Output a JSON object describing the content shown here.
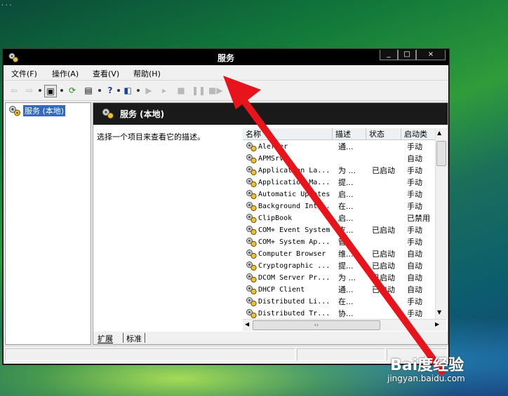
{
  "window": {
    "title": "服务",
    "controls": {
      "minimize": "_",
      "maximize": "□",
      "close": "×"
    }
  },
  "menubar": {
    "items": [
      {
        "label": "文件(F)"
      },
      {
        "label": "操作(A)"
      },
      {
        "label": "查看(V)"
      },
      {
        "label": "帮助(H)"
      }
    ]
  },
  "toolbar": {
    "icons": [
      "back-arrow-icon",
      "forward-arrow-icon",
      "show-hide-tree-icon",
      "refresh-icon",
      "export-list-icon",
      "help-icon",
      "console-view-icon",
      "start-service-icon",
      "play-icon",
      "stop-service-icon",
      "pause-service-icon",
      "restart-service-icon"
    ]
  },
  "tree": {
    "root_label": "服务 (本地)"
  },
  "right_pane": {
    "header_title": "服务 (本地)",
    "description_prompt": "选择一个项目来查看它的描述。",
    "columns": [
      "名称",
      "描述",
      "状态",
      "启动类"
    ],
    "rows": [
      {
        "name": "Alerter",
        "desc": "通...",
        "status": "",
        "startup": "手动"
      },
      {
        "name": "APMSrv",
        "desc": "",
        "status": "",
        "startup": "自动"
      },
      {
        "name": "Application La...",
        "desc": "为 ...",
        "status": "已启动",
        "startup": "手动"
      },
      {
        "name": "Application Ma...",
        "desc": "提...",
        "status": "",
        "startup": "手动"
      },
      {
        "name": "Automatic Updates",
        "desc": "启...",
        "status": "",
        "startup": "手动"
      },
      {
        "name": "Background Int...",
        "desc": "在...",
        "status": "",
        "startup": "手动"
      },
      {
        "name": "ClipBook",
        "desc": "启...",
        "status": "",
        "startup": "已禁用"
      },
      {
        "name": "COM+ Event System",
        "desc": "支...",
        "status": "已启动",
        "startup": "手动"
      },
      {
        "name": "COM+ System Ap...",
        "desc": "管...",
        "status": "",
        "startup": "手动"
      },
      {
        "name": "Computer Browser",
        "desc": "维...",
        "status": "已启动",
        "startup": "自动"
      },
      {
        "name": "Cryptographic ...",
        "desc": "提...",
        "status": "已启动",
        "startup": "自动"
      },
      {
        "name": "DCOM Server Pr...",
        "desc": "为 ...",
        "status": "已启动",
        "startup": "自动"
      },
      {
        "name": "DHCP Client",
        "desc": "通...",
        "status": "已启动",
        "startup": "自动"
      },
      {
        "name": "Distributed Li...",
        "desc": "在...",
        "status": "",
        "startup": "手动"
      },
      {
        "name": "Distributed Tr...",
        "desc": "协...",
        "status": "",
        "startup": "手动"
      }
    ],
    "tabs": [
      "扩展",
      "标准"
    ]
  },
  "watermark": {
    "logo_text": "Bai度经验",
    "url": "jingyan.baidu.com"
  },
  "colors": {
    "selection": "#316ac5",
    "annotation_arrow": "#e8141b",
    "title_bar": "#000000"
  }
}
